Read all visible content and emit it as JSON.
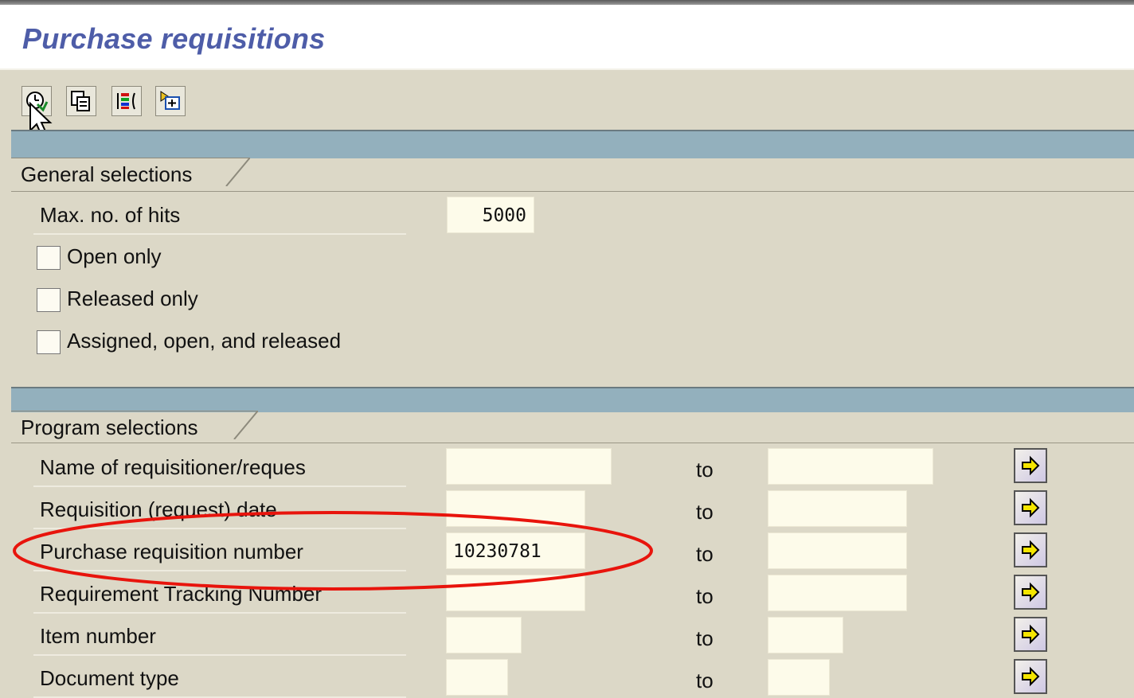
{
  "title": "Purchase requisitions",
  "toolbar": {
    "icons": [
      "execute-icon",
      "get-variant-icon",
      "selection-options-icon",
      "dynamic-selections-icon"
    ]
  },
  "general": {
    "frame_title": "General selections",
    "max_hits_label": "Max. no. of hits",
    "max_hits_value": "5000",
    "open_only_label": "Open only",
    "open_only_checked": false,
    "released_only_label": "Released only",
    "released_only_checked": false,
    "assigned_label": "Assigned, open, and released",
    "assigned_checked": false
  },
  "program": {
    "frame_title": "Program selections",
    "to_label": "to",
    "rows": [
      {
        "label": "Name of requisitioner/reques",
        "from": "",
        "to": ""
      },
      {
        "label": "Requisition (request) date",
        "from": "",
        "to": ""
      },
      {
        "label": "Purchase requisition number",
        "from": "10230781",
        "to": ""
      },
      {
        "label": "Requirement Tracking Number",
        "from": "",
        "to": ""
      },
      {
        "label": "Item number",
        "from": "",
        "to": ""
      },
      {
        "label": "Document type",
        "from": "",
        "to": ""
      }
    ]
  },
  "colors": {
    "title": "#4e5da8",
    "band": "#93b0bd",
    "background": "#dcd8c7",
    "input": "#fdfbea",
    "highlight": "#e8140c"
  }
}
